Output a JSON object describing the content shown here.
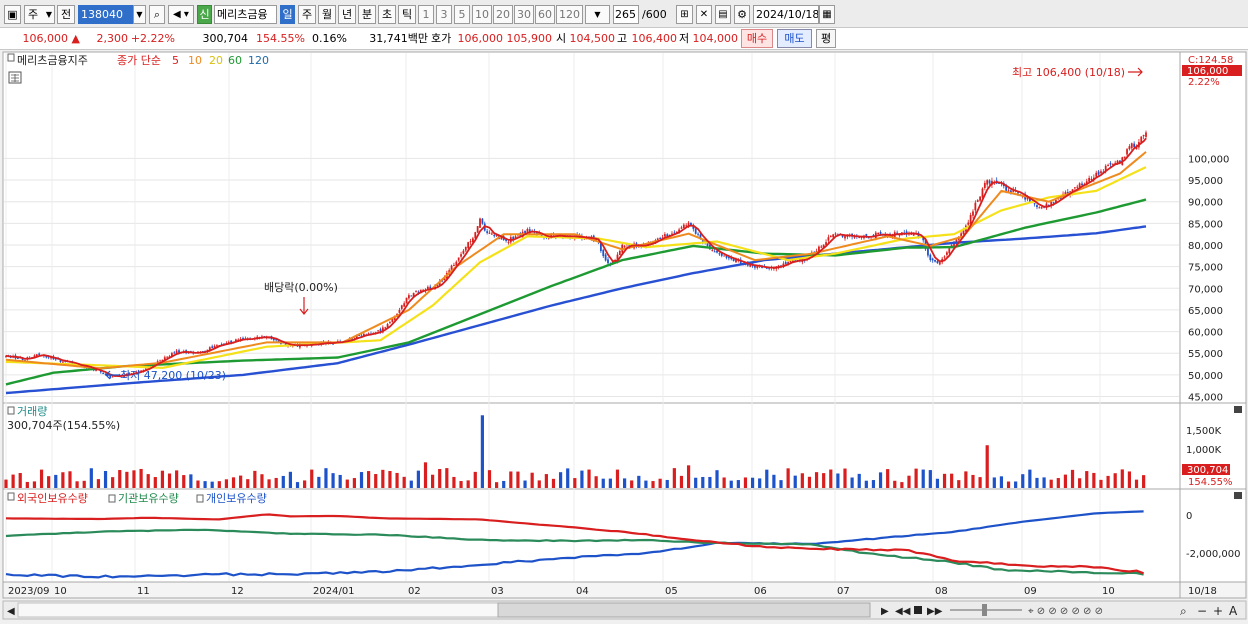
{
  "toolbar": {
    "market": "주",
    "type": "전",
    "code": "138040",
    "badge": "신",
    "name": "메리츠금융",
    "periods": [
      "일",
      "주",
      "월",
      "년",
      "분",
      "초",
      "틱"
    ],
    "active_period": "일",
    "minutes": [
      "1",
      "3",
      "5",
      "10",
      "20",
      "30",
      "60",
      "120"
    ],
    "count": "265",
    "count_max": "/600",
    "date": "2024/10/18"
  },
  "quote": {
    "price": "106,000 ▲",
    "change": "2,300",
    "change_pct": "+2.22%",
    "volume": "300,704",
    "volume_ratio": "154.55%",
    "turnover_rate": "0.16%",
    "amount": "31,741백만",
    "bid_ask_label": "호가",
    "ask": "106,000",
    "bid": "105,900",
    "open_label": "시",
    "open": "104,500",
    "high_label": "고",
    "high": "106,400",
    "low_label": "저",
    "low": "104,000",
    "buy_btn": "매수",
    "sell_btn": "매도",
    "eval_btn": "평"
  },
  "colors": {
    "up": "#d81e1e",
    "down": "#1d52c9",
    "ma5": "#d81e1e",
    "ma10": "#ee8a1e",
    "ma20": "#f5e11a",
    "ma60": "#1e9a32",
    "ma120": "#2850d2"
  },
  "chart_data": [
    {
      "type": "candlestick",
      "title": "메리츠금융지주",
      "indicator": "종가 단순",
      "ma_periods": [
        "5",
        "10",
        "20",
        "60",
        "120"
      ],
      "ylim": [
        43500,
        124580
      ],
      "yticks": [
        "45,000",
        "50,000",
        "55,000",
        "60,000",
        "65,000",
        "70,000",
        "75,000",
        "80,000",
        "85,000",
        "90,000",
        "95,000",
        "100,000"
      ],
      "top_label": "C:124.58",
      "last_value": "106,000",
      "last_pct": "2.22%",
      "x_labels": [
        "2023/09",
        "10",
        "11",
        "12",
        "2024/01",
        "02",
        "03",
        "04",
        "05",
        "06",
        "07",
        "08",
        "09",
        "10"
      ],
      "right_date": "10/18",
      "annotations": {
        "high": "최고 106,400 (10/18)",
        "low": "최저 47,200 (10/23)",
        "dividend": "배당락(0.00%)"
      },
      "close_path": [
        [
          0,
          54300
        ],
        [
          8,
          53600
        ],
        [
          14,
          54800
        ],
        [
          20,
          53600
        ],
        [
          30,
          52500
        ],
        [
          40,
          50800
        ],
        [
          44,
          49500
        ],
        [
          50,
          49900
        ],
        [
          58,
          51300
        ],
        [
          66,
          53500
        ],
        [
          72,
          55400
        ],
        [
          78,
          55000
        ],
        [
          84,
          55400
        ],
        [
          88,
          56700
        ],
        [
          98,
          58100
        ],
        [
          110,
          58900
        ],
        [
          120,
          56700
        ],
        [
          130,
          57200
        ],
        [
          142,
          57600
        ],
        [
          150,
          59100
        ],
        [
          158,
          60100
        ],
        [
          164,
          63400
        ],
        [
          170,
          68300
        ],
        [
          176,
          69800
        ],
        [
          180,
          70100
        ],
        [
          184,
          71700
        ],
        [
          188,
          74800
        ],
        [
          194,
          79600
        ],
        [
          198,
          82800
        ],
        [
          200,
          85800
        ],
        [
          202,
          83500
        ],
        [
          206,
          81900
        ],
        [
          212,
          81100
        ],
        [
          216,
          82200
        ],
        [
          220,
          83200
        ],
        [
          226,
          82100
        ],
        [
          232,
          81900
        ],
        [
          238,
          82100
        ],
        [
          242,
          81600
        ],
        [
          246,
          82100
        ],
        [
          250,
          80600
        ],
        [
          252,
          77100
        ],
        [
          255,
          75000
        ],
        [
          260,
          79800
        ],
        [
          266,
          80100
        ],
        [
          272,
          80400
        ],
        [
          278,
          82300
        ],
        [
          284,
          83600
        ],
        [
          288,
          85000
        ],
        [
          292,
          82400
        ],
        [
          296,
          79700
        ],
        [
          302,
          77800
        ],
        [
          310,
          75900
        ],
        [
          316,
          75100
        ],
        [
          322,
          74700
        ],
        [
          328,
          75500
        ],
        [
          334,
          76600
        ],
        [
          338,
          76800
        ],
        [
          342,
          78800
        ],
        [
          348,
          82100
        ],
        [
          352,
          82400
        ],
        [
          358,
          81600
        ],
        [
          364,
          81700
        ],
        [
          368,
          82700
        ],
        [
          372,
          82100
        ],
        [
          376,
          82700
        ],
        [
          380,
          82600
        ],
        [
          386,
          82200
        ],
        [
          390,
          76200
        ],
        [
          394,
          75900
        ],
        [
          398,
          79400
        ],
        [
          402,
          82100
        ],
        [
          406,
          85600
        ],
        [
          410,
          90500
        ],
        [
          414,
          94900
        ],
        [
          418,
          94400
        ],
        [
          422,
          93100
        ],
        [
          426,
          92200
        ],
        [
          432,
          90300
        ],
        [
          436,
          88700
        ],
        [
          440,
          89200
        ],
        [
          446,
          91600
        ],
        [
          452,
          93400
        ],
        [
          458,
          95700
        ],
        [
          464,
          97700
        ],
        [
          470,
          99200
        ],
        [
          474,
          102700
        ],
        [
          478,
          103700
        ],
        [
          481,
          106000
        ]
      ],
      "ma_values": {
        "ma10": [
          [
            0,
            53500
          ],
          [
            40,
            51500
          ],
          [
            66,
            52800
          ],
          [
            110,
            57500
          ],
          [
            142,
            57500
          ],
          [
            170,
            65000
          ],
          [
            190,
            75000
          ],
          [
            210,
            82500
          ],
          [
            240,
            82500
          ],
          [
            260,
            79000
          ],
          [
            288,
            82600
          ],
          [
            316,
            76500
          ],
          [
            340,
            78000
          ],
          [
            372,
            82000
          ],
          [
            390,
            79800
          ],
          [
            404,
            82000
          ],
          [
            420,
            92500
          ],
          [
            440,
            90000
          ],
          [
            470,
            96500
          ],
          [
            481,
            101500
          ]
        ],
        "ma20": [
          [
            0,
            53000
          ],
          [
            40,
            52200
          ],
          [
            66,
            51600
          ],
          [
            110,
            56500
          ],
          [
            158,
            58000
          ],
          [
            180,
            66000
          ],
          [
            200,
            76000
          ],
          [
            220,
            82000
          ],
          [
            250,
            81500
          ],
          [
            270,
            79500
          ],
          [
            300,
            80800
          ],
          [
            330,
            76500
          ],
          [
            350,
            78000
          ],
          [
            380,
            81500
          ],
          [
            400,
            82500
          ],
          [
            420,
            88000
          ],
          [
            440,
            91000
          ],
          [
            460,
            92500
          ],
          [
            481,
            98000
          ]
        ],
        "ma60": [
          [
            0,
            47800
          ],
          [
            20,
            50500
          ],
          [
            50,
            52000
          ],
          [
            100,
            53300
          ],
          [
            140,
            54000
          ],
          [
            170,
            57500
          ],
          [
            200,
            64000
          ],
          [
            230,
            70500
          ],
          [
            260,
            76500
          ],
          [
            290,
            79800
          ],
          [
            320,
            78000
          ],
          [
            350,
            77600
          ],
          [
            380,
            79400
          ],
          [
            400,
            79500
          ],
          [
            430,
            84000
          ],
          [
            460,
            87500
          ],
          [
            481,
            90500
          ]
        ],
        "ma120": [
          [
            0,
            45800
          ],
          [
            50,
            48000
          ],
          [
            100,
            50000
          ],
          [
            140,
            52700
          ],
          [
            170,
            57000
          ],
          [
            200,
            61500
          ],
          [
            230,
            66000
          ],
          [
            260,
            70000
          ],
          [
            290,
            73500
          ],
          [
            320,
            76500
          ],
          [
            350,
            78000
          ],
          [
            380,
            79500
          ],
          [
            400,
            80500
          ],
          [
            430,
            81500
          ],
          [
            460,
            82700
          ],
          [
            481,
            84300
          ]
        ]
      }
    },
    {
      "type": "bar",
      "title": "거래량",
      "subtitle": "300,704주(154.55%)",
      "yticks": [
        "1,500K",
        "1,000K"
      ],
      "ylim": [
        0,
        1800000
      ],
      "last_value": "300,704",
      "last_pct": "154.55%",
      "typical_volume": 300000,
      "spikes": [
        [
          200,
          1700000
        ],
        [
          414,
          1000000
        ],
        [
          288,
          530000
        ],
        [
          176,
          600000
        ],
        [
          130,
          430000
        ]
      ]
    },
    {
      "type": "line",
      "series": [
        {
          "name": "외국인보유수량"
        },
        {
          "name": "기관보유수량"
        },
        {
          "name": "개인보유수량"
        }
      ],
      "yticks": [
        "0",
        "-2,000,000"
      ],
      "ylim": [
        -3200000,
        600000
      ],
      "foreign_path": [
        [
          0,
          -150000
        ],
        [
          40,
          -180000
        ],
        [
          60,
          -120000
        ],
        [
          90,
          -200000
        ],
        [
          110,
          50000
        ],
        [
          120,
          -50000
        ],
        [
          140,
          -30000
        ],
        [
          160,
          -150000
        ],
        [
          200,
          -200000
        ],
        [
          230,
          -500000
        ],
        [
          260,
          -800000
        ],
        [
          290,
          -1200000
        ],
        [
          320,
          -1550000
        ],
        [
          350,
          -1650000
        ],
        [
          380,
          -1700000
        ],
        [
          400,
          -2200000
        ],
        [
          430,
          -2450000
        ],
        [
          460,
          -2500000
        ],
        [
          481,
          -2800000
        ]
      ],
      "institution_path": [
        [
          0,
          -1000000
        ],
        [
          40,
          -800000
        ],
        [
          80,
          -700000
        ],
        [
          120,
          -900000
        ],
        [
          160,
          -950000
        ],
        [
          200,
          -1200000
        ],
        [
          240,
          -1250000
        ],
        [
          270,
          -1200000
        ],
        [
          300,
          -1350000
        ],
        [
          340,
          -1400000
        ],
        [
          360,
          -1800000
        ],
        [
          400,
          -2300000
        ],
        [
          420,
          -2650000
        ],
        [
          440,
          -2700000
        ],
        [
          460,
          -2800000
        ],
        [
          481,
          -2850000
        ]
      ],
      "individual_path": [
        [
          0,
          -2900000
        ],
        [
          40,
          -3000000
        ],
        [
          80,
          -2900000
        ],
        [
          120,
          -2850000
        ],
        [
          160,
          -2750000
        ],
        [
          200,
          -2400000
        ],
        [
          240,
          -2050000
        ],
        [
          270,
          -1850000
        ],
        [
          300,
          -1350000
        ],
        [
          340,
          -1400000
        ],
        [
          360,
          -1200000
        ],
        [
          400,
          -800000
        ],
        [
          430,
          -300000
        ],
        [
          460,
          100000
        ],
        [
          481,
          200000
        ]
      ]
    }
  ],
  "scroll": {
    "left_arrow": "◀",
    "right_arrow": "▶"
  }
}
